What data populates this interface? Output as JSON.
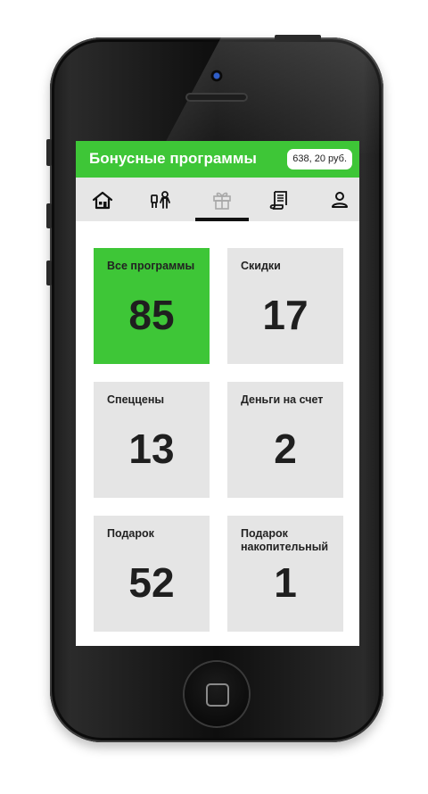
{
  "header": {
    "title": "Бонусные программы",
    "balance": "638, 20 руб."
  },
  "tabs": [
    {
      "name": "home",
      "icon": "house-icon",
      "active": false
    },
    {
      "name": "people",
      "icon": "people-icon",
      "active": false
    },
    {
      "name": "bonus",
      "icon": "gift-icon",
      "active": true
    },
    {
      "name": "documents",
      "icon": "scroll-icon",
      "active": false
    },
    {
      "name": "profile",
      "icon": "person-icon",
      "active": false
    }
  ],
  "tiles": [
    {
      "label": "Все программы",
      "count": "85",
      "active": true
    },
    {
      "label": "Скидки",
      "count": "17",
      "active": false
    },
    {
      "label": "Спеццены",
      "count": "13",
      "active": false
    },
    {
      "label": "Деньги на счет",
      "count": "2",
      "active": false
    },
    {
      "label": "Подарок",
      "count": "52",
      "active": false
    },
    {
      "label": "Подарок накопительный",
      "count": "1",
      "active": false
    }
  ],
  "colors": {
    "accent": "#3ec637",
    "tile": "#e5e5e5",
    "tabbar": "#e6e6e6",
    "text": "#1f1f1f"
  }
}
